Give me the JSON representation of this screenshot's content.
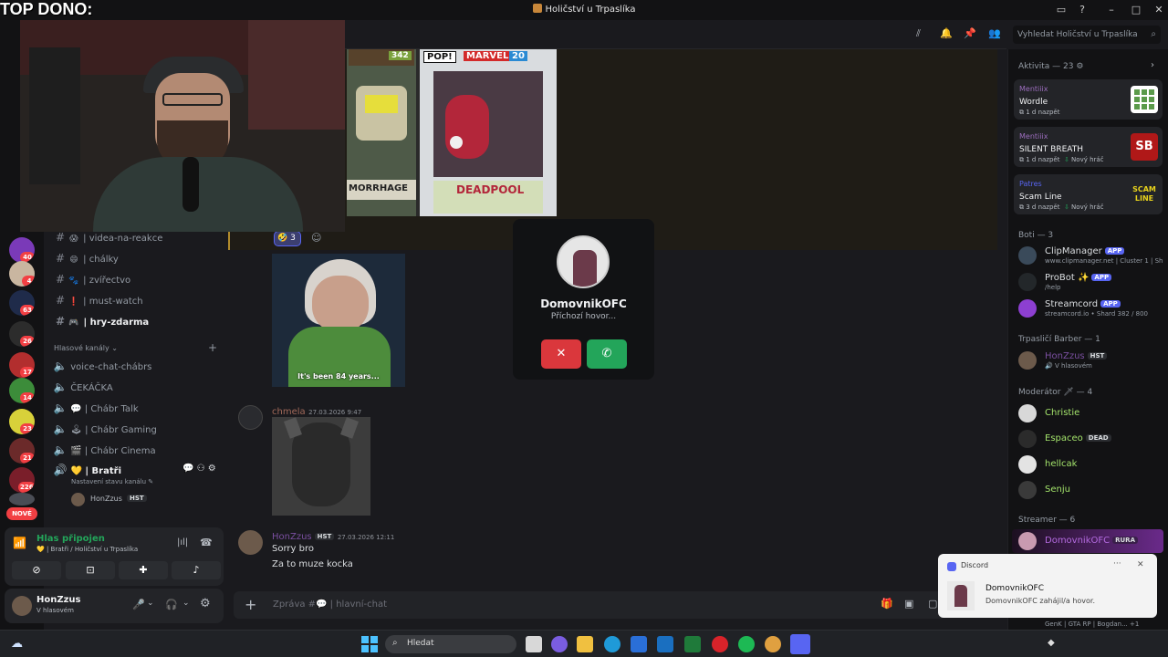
{
  "window": {
    "title": "Holičství u Trpaslíka"
  },
  "overlay": {
    "label": "TOP DONO:"
  },
  "servers": [
    {
      "badge": "40"
    },
    {
      "badge": "4"
    },
    {
      "badge": "63"
    },
    {
      "badge": "26"
    },
    {
      "badge": "17"
    },
    {
      "badge": "14"
    },
    {
      "badge": "23"
    },
    {
      "badge": "21"
    },
    {
      "badge": "226"
    }
  ],
  "rail": {
    "new_label": "NOVÉ"
  },
  "channels": {
    "text": [
      {
        "emoji": "😱",
        "name": "videa-na-reakce"
      },
      {
        "emoji": "😄",
        "name": "chálky"
      },
      {
        "emoji": "🐾",
        "name": "zvířectvo"
      },
      {
        "emoji": "❗",
        "name": "must-watch"
      },
      {
        "emoji": "🎮",
        "name": "hry-zdarma"
      }
    ],
    "voice_header": "Hlasové kanály",
    "voice": [
      {
        "name": "voice-chat-chábrs"
      },
      {
        "name": "ČEKÁČKA"
      },
      {
        "emoji": "💬",
        "name": "Chábr Talk"
      },
      {
        "emoji": "🕹",
        "name": "Chábr Gaming"
      },
      {
        "emoji": "🎬",
        "name": "Chábr Cinema"
      }
    ],
    "active_voice": {
      "name": "💛 | Bratři",
      "status": "Nastavení stavu kanálu"
    },
    "voice_member": {
      "name": "HonZzus",
      "tag": "HST"
    }
  },
  "voice_panel": {
    "status": "Hlas připojen",
    "location": "💛 | Bratři / Holičství u Trpaslíka"
  },
  "user_panel": {
    "name": "HonZzus",
    "status": "V hlasovém"
  },
  "header": {
    "search_placeholder": "Vyhledat Holičství u Trpaslíka"
  },
  "messages": [
    {
      "reaction_count": "3",
      "gif_caption": "It's been 84 years..."
    },
    {
      "author": "chmela",
      "time": "27.03.2026 9:47"
    },
    {
      "author": "HonZzus",
      "tag": "HST",
      "time": "27.03.2026 12:11",
      "lines": [
        "Sorry bro",
        "Za to muze kocka"
      ]
    }
  ],
  "media_labels": {
    "funko_left_num": "342",
    "funko_right_brand": "MARVEL",
    "funko_right_num": "20",
    "funko_pop": "POP!",
    "funko_left_name": "MORRHAGE",
    "funko_right_name": "DEADPOOL"
  },
  "composer": {
    "placeholder": "Zpráva #💬 | hlavní-chat"
  },
  "call": {
    "name": "DomovnikOFC",
    "status": "Příchozí hovor..."
  },
  "members": {
    "activity_header": "Aktivita — 23",
    "activities": [
      {
        "user": "Mentiiix",
        "game": "Wordle",
        "meta": "1 d nazpět",
        "extra": ""
      },
      {
        "user": "Mentiiix",
        "game": "SILENT BREATH",
        "meta": "1 d nazpět",
        "extra": "Nový hráč"
      },
      {
        "user": "Patres",
        "game": "Scam Line",
        "meta": "3 d nazpět",
        "extra": "Nový hráč"
      }
    ],
    "bots_header": "Boti — 3",
    "bots": [
      {
        "name": "ClipManager",
        "sub": "www.clipmanager.net | Cluster 1 | Sh"
      },
      {
        "name": "ProBot ✨",
        "sub": "/help"
      },
      {
        "name": "Streamcord",
        "sub": "streamcord.io • Shard 382 / 800"
      }
    ],
    "app_label": "APP",
    "barber_header": "Trpasličí Barber — 1",
    "barber": {
      "name": "HonZzus",
      "tag": "HST",
      "sub": "V hlasovém"
    },
    "mod_header": "Moderátor 🗡 — 4",
    "mods": [
      {
        "name": "Christie",
        "tag": ""
      },
      {
        "name": "Espaceo",
        "tag": "DEAD"
      },
      {
        "name": "hellcak",
        "tag": ""
      },
      {
        "name": "Senju",
        "tag": ""
      }
    ],
    "streamer_header": "Streamer — 6",
    "streamer": {
      "name": "DomovnikOFC",
      "tag": "RURA"
    },
    "bottom_sub": "GenK | GTA RP | Bogdan... +1"
  },
  "toast": {
    "app": "Discord",
    "title": "DomovnikOFC",
    "body": "DomovnikOFC zahájil/a hovor."
  },
  "taskbar": {
    "search": "Hledat"
  },
  "colors": {
    "accent": "#5865f2",
    "online": "#23a55a",
    "danger": "#da373c",
    "activity_name": "#9b6dbd"
  }
}
